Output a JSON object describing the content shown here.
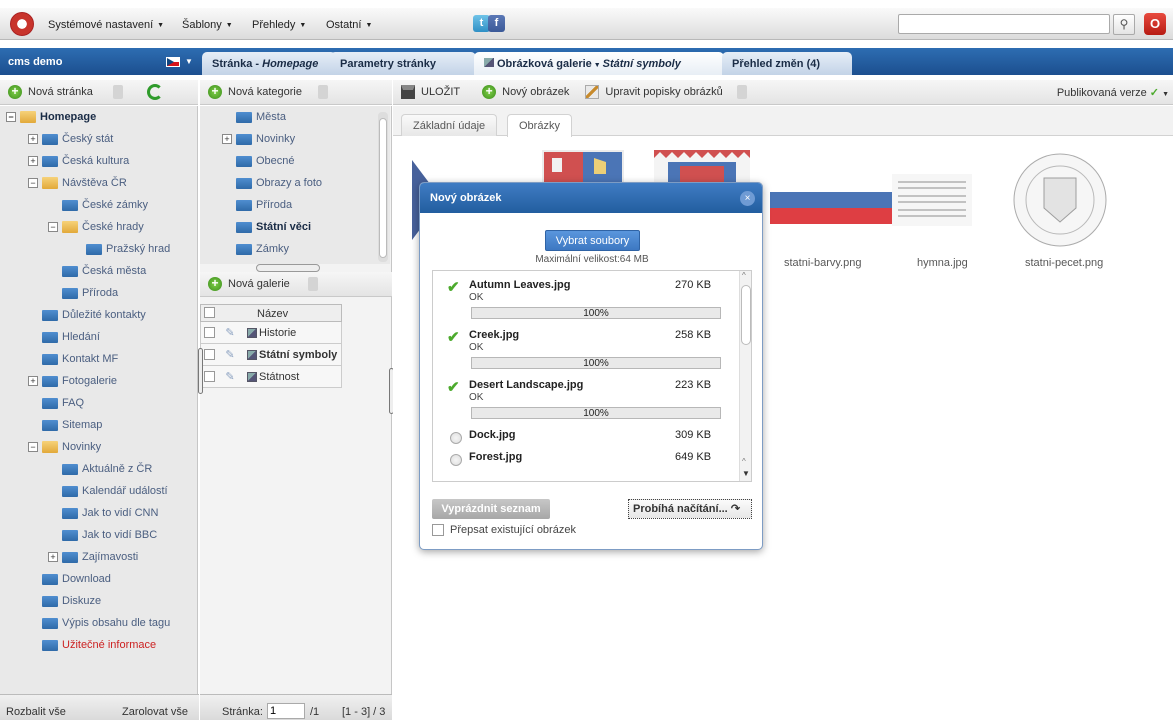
{
  "topmenu": {
    "items": [
      "Systémové nastavení",
      "Šablony",
      "Přehledy",
      "Ostatní"
    ],
    "search_placeholder": "",
    "twitter_label": "t",
    "facebook_label": "f",
    "search_glyph": "⚲",
    "power_glyph": "O"
  },
  "tabbar": {
    "site": "cms demo",
    "tabs": [
      "Stránka - ",
      "Homepage",
      "Parametry stránky",
      "Obrázková galerie",
      "Státní symboly",
      "Přehled změn (4)"
    ]
  },
  "left_toolbar": {
    "new_page": "Nová stránka"
  },
  "mid_toolbar": {
    "new_category": "Nová kategorie",
    "new_gallery": "Nová galerie"
  },
  "content_toolbar": {
    "save": "ULOŽIT",
    "new_image": "Nový obrázek",
    "edit_descriptions": "Upravit popisky obrázků",
    "published": "Publikovaná verze"
  },
  "tree": [
    {
      "label": "Homepage",
      "indent": 0,
      "expander": "-",
      "type": "open",
      "style": "bold"
    },
    {
      "label": "Český stát",
      "indent": 1,
      "expander": "+",
      "type": "folder",
      "style": ""
    },
    {
      "label": "Česká kultura",
      "indent": 1,
      "expander": "+",
      "type": "folder",
      "style": ""
    },
    {
      "label": "Návštěva ČR",
      "indent": 1,
      "expander": "-",
      "type": "open",
      "style": ""
    },
    {
      "label": "České zámky",
      "indent": 2,
      "expander": "",
      "type": "folder",
      "style": ""
    },
    {
      "label": "České hrady",
      "indent": 2,
      "expander": "-",
      "type": "open",
      "style": ""
    },
    {
      "label": "Pražský hrad",
      "indent": 3,
      "expander": "",
      "type": "folder",
      "style": ""
    },
    {
      "label": "Česká města",
      "indent": 2,
      "expander": "",
      "type": "folder",
      "style": ""
    },
    {
      "label": "Příroda",
      "indent": 2,
      "expander": "",
      "type": "folder",
      "style": ""
    },
    {
      "label": "Důležité kontakty",
      "indent": 1,
      "expander": "",
      "type": "folder",
      "style": ""
    },
    {
      "label": "Hledání",
      "indent": 1,
      "expander": "",
      "type": "folder",
      "style": ""
    },
    {
      "label": "Kontakt MF",
      "indent": 1,
      "expander": "",
      "type": "folder",
      "style": ""
    },
    {
      "label": "Fotogalerie",
      "indent": 1,
      "expander": "+",
      "type": "folder",
      "style": ""
    },
    {
      "label": "FAQ",
      "indent": 1,
      "expander": "",
      "type": "folder",
      "style": ""
    },
    {
      "label": "Sitemap",
      "indent": 1,
      "expander": "",
      "type": "folder",
      "style": ""
    },
    {
      "label": "Novinky",
      "indent": 1,
      "expander": "-",
      "type": "open",
      "style": ""
    },
    {
      "label": "Aktuálně z ČR",
      "indent": 2,
      "expander": "",
      "type": "folder",
      "style": ""
    },
    {
      "label": "Kalendář událostí",
      "indent": 2,
      "expander": "",
      "type": "folder",
      "style": ""
    },
    {
      "label": "Jak to vidí CNN",
      "indent": 2,
      "expander": "",
      "type": "folder",
      "style": ""
    },
    {
      "label": "Jak to vidí BBC",
      "indent": 2,
      "expander": "",
      "type": "folder",
      "style": ""
    },
    {
      "label": "Zajímavosti",
      "indent": 2,
      "expander": "+",
      "type": "folder",
      "style": ""
    },
    {
      "label": "Download",
      "indent": 1,
      "expander": "",
      "type": "folder",
      "style": ""
    },
    {
      "label": "Diskuze",
      "indent": 1,
      "expander": "",
      "type": "folder",
      "style": ""
    },
    {
      "label": "Výpis obsahu dle tagu",
      "indent": 1,
      "expander": "",
      "type": "folder",
      "style": ""
    },
    {
      "label": "Užitečné informace",
      "indent": 1,
      "expander": "",
      "type": "folder",
      "style": "red"
    }
  ],
  "tree_footer": {
    "expand_all": "Rozbalit vše",
    "collapse_all": "Zarolovat vše"
  },
  "categories": [
    {
      "label": "Města",
      "expander": "",
      "bold": false
    },
    {
      "label": "Novinky",
      "expander": "+",
      "bold": false
    },
    {
      "label": "Obecné",
      "expander": "",
      "bold": false
    },
    {
      "label": "Obrazy a foto",
      "expander": "",
      "bold": false
    },
    {
      "label": "Příroda",
      "expander": "",
      "bold": false
    },
    {
      "label": "Státní věci",
      "expander": "",
      "bold": true
    },
    {
      "label": "Zámky",
      "expander": "",
      "bold": false
    }
  ],
  "galleries": {
    "header": "Název",
    "rows": [
      {
        "label": "Historie",
        "bold": false
      },
      {
        "label": "Státní symboly",
        "bold": true
      },
      {
        "label": "Státnost",
        "bold": false
      }
    ]
  },
  "mid_footer": {
    "page_label": "Stránka:",
    "page": "1",
    "total": "/1",
    "range": "[1 - 3] / 3"
  },
  "subtabs": [
    "Základní údaje",
    "Obrázky"
  ],
  "thumbnails": [
    "statni-barvy.png",
    "hymna.jpg",
    "statni-pecet.png"
  ],
  "dialog": {
    "title": "Nový obrázek",
    "close": "×",
    "select_button": "Vybrat soubory",
    "max_size": "Maximální velikost:64 MB",
    "files": [
      {
        "name": "Autumn Leaves.jpg",
        "size": "270 KB",
        "status": "OK",
        "progress": "100%",
        "done": true
      },
      {
        "name": "Creek.jpg",
        "size": "258 KB",
        "status": "OK",
        "progress": "100%",
        "done": true
      },
      {
        "name": "Desert Landscape.jpg",
        "size": "223 KB",
        "status": "OK",
        "progress": "100%",
        "done": true
      },
      {
        "name": "Dock.jpg",
        "size": "309 KB",
        "status": "",
        "progress": "",
        "done": false
      },
      {
        "name": "Forest.jpg",
        "size": "649 KB",
        "status": "",
        "progress": "",
        "done": false
      }
    ],
    "clear_button": "Vyprázdnit seznam",
    "loading_button": "Probíhá načítání...",
    "overwrite_label": "Přepsat existující obrázek"
  },
  "colors": {
    "tabbar": "#225e9f",
    "accent_red": "#cc2222",
    "ok_green": "#4caa2d"
  }
}
